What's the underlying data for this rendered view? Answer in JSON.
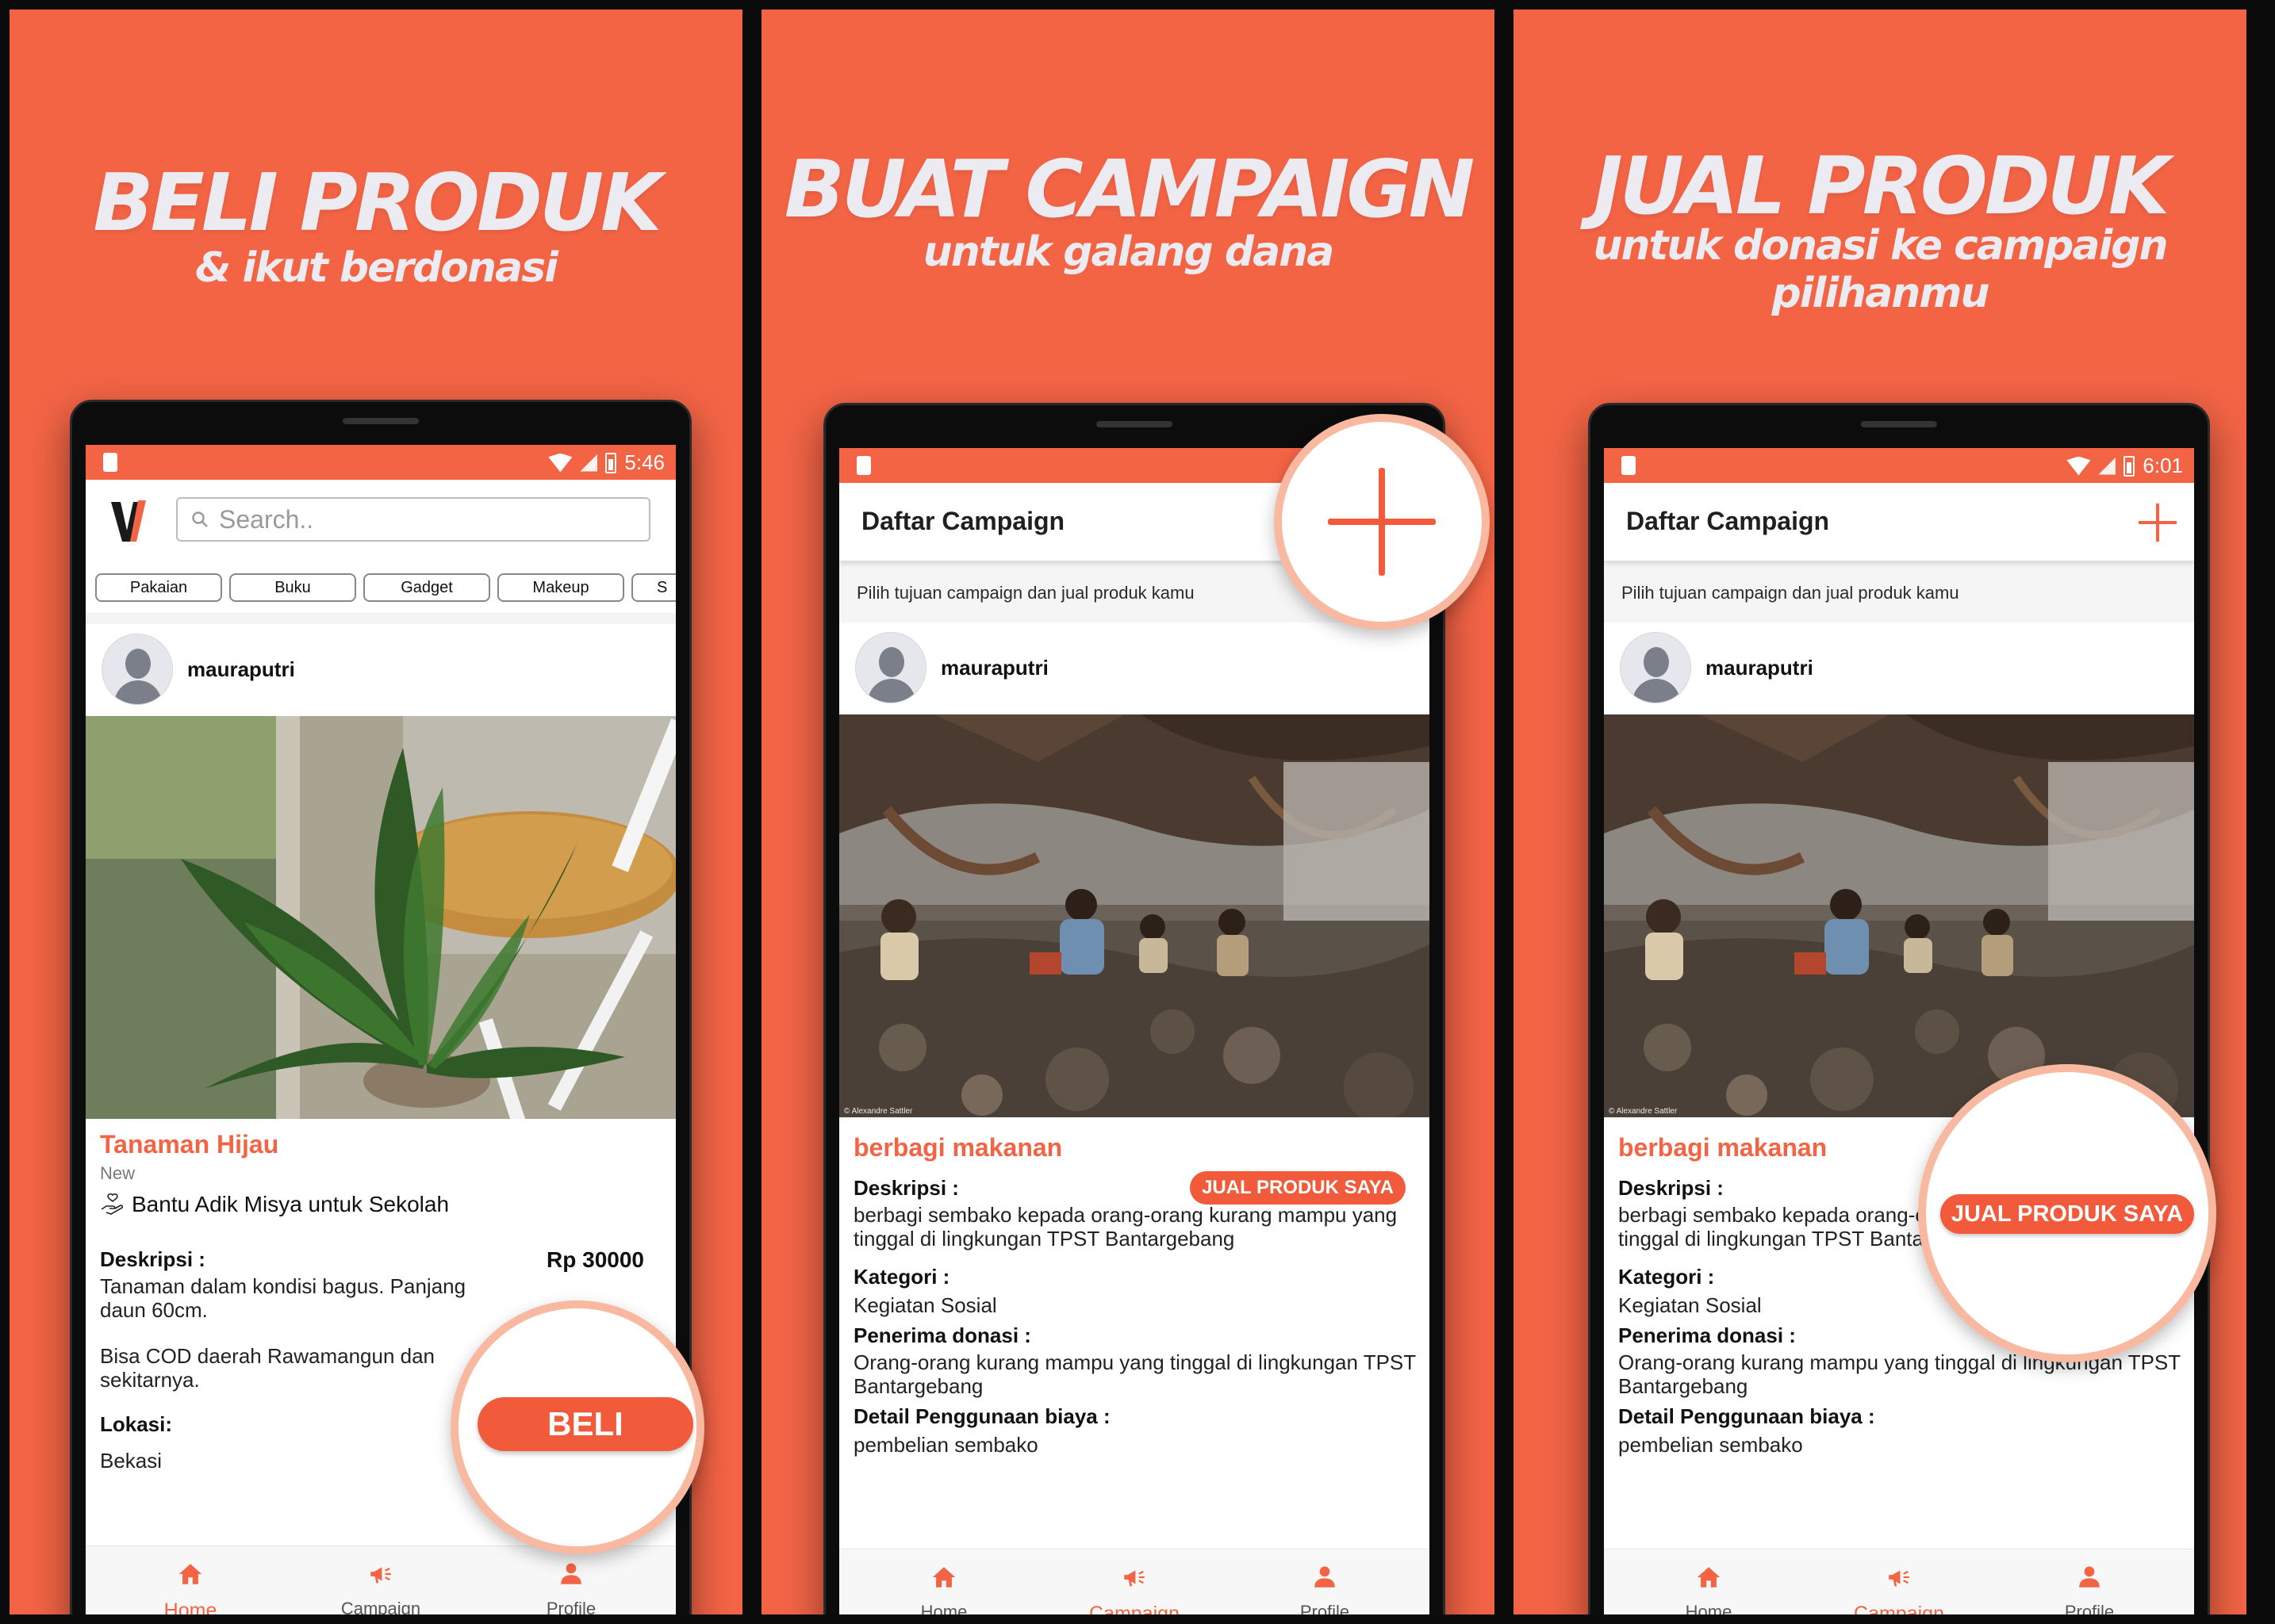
{
  "panels": [
    {
      "headline": "BELI PRODUK",
      "subhead": "& ikut berdonasi",
      "status_time": "5:46",
      "search_placeholder": "Search..",
      "categories": [
        "Pakaian",
        "Buku",
        "Gadget",
        "Makeup",
        "S"
      ],
      "username": "mauraputri",
      "product": {
        "title": "Tanaman Hijau",
        "condition": "New",
        "campaign": "Bantu Adik Misya untuk Sekolah",
        "description_label": "Deskripsi :",
        "description_line1": "Tanaman dalam kondisi bagus. Panjang",
        "description_line2": "daun 60cm.",
        "description_line3": "Bisa COD daerah Rawamangun dan",
        "description_line4": "sekitarnya.",
        "price": "Rp 30000",
        "location_label": "Lokasi:",
        "location": "Bekasi"
      },
      "buy_button": "BELI"
    },
    {
      "headline": "BUAT CAMPAIGN",
      "subhead": "untuk galang dana"
    },
    {
      "headline": "JUAL PRODUK",
      "subhead": "untuk donasi ke campaign pilihanmu",
      "status_time": "6:01"
    }
  ],
  "campaign": {
    "appbar_title": "Daftar Campaign",
    "hint": "Pilih tujuan campaign dan jual produk kamu",
    "username": "mauraputri",
    "photo_credit": "© Alexandre Sattler",
    "title": "berbagi makanan",
    "sell_button": "JUAL PRODUK SAYA",
    "description_label": "Deskripsi :",
    "description_line1": "berbagi sembako kepada orang-orang kurang mampu yang",
    "description_line2": "tinggal di lingkungan TPST Bantargebang",
    "category_label": "Kategori :",
    "category": "Kegiatan Sosial",
    "recipient_label": "Penerima donasi :",
    "recipient_line1": "Orang-orang kurang mampu yang tinggal di lingkungan TPST",
    "recipient_line2": "Bantargebang",
    "usage_label": "Detail Penggunaan biaya :",
    "usage": "pembelian sembako"
  },
  "nav": {
    "home": "Home",
    "campaign": "Campaign",
    "profile": "Profile"
  },
  "colors": {
    "brand": "#F36445",
    "button": "#F15A3B",
    "magnifier_ring": "#F9B9A1"
  },
  "icons": [
    "search-icon",
    "home-icon",
    "megaphone-icon",
    "person-icon",
    "plus-icon",
    "wifi-icon",
    "signal-icon",
    "battery-icon",
    "hand-heart-icon"
  ]
}
